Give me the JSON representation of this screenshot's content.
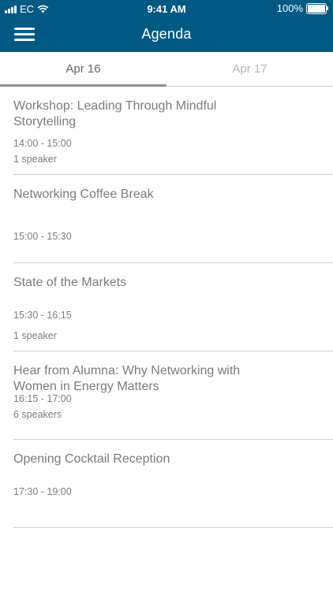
{
  "status_bar": {
    "carrier": "EC",
    "time": "9:41 AM",
    "battery": "100%"
  },
  "nav": {
    "title": "Agenda",
    "menu_icon": "hamburger-menu-icon"
  },
  "tabs": [
    {
      "label": "Apr 16",
      "active": true
    },
    {
      "label": "Apr 17",
      "active": false
    }
  ],
  "sessions": [
    {
      "title": "Workshop: Leading Through Mindful Storytelling",
      "time": "14:00 - 15:00",
      "speakers": "1 speaker"
    },
    {
      "title": "Networking Coffee Break",
      "time": "15:00 - 15:30",
      "speakers": ""
    },
    {
      "title": "State of the Markets",
      "time": "15:30 - 16:15",
      "speakers": "1 speaker"
    },
    {
      "title": "Hear from Alumna: Why Networking with Women in Energy Matters",
      "time": "16:15 - 17:00",
      "speakers": "6 speakers"
    },
    {
      "title": "Opening Cocktail Reception",
      "time": "17:30 - 19:00",
      "speakers": ""
    }
  ],
  "colors": {
    "header_bg": "#015a84",
    "text_gray": "#7b7b7b",
    "divider": "#cfcfcf"
  }
}
